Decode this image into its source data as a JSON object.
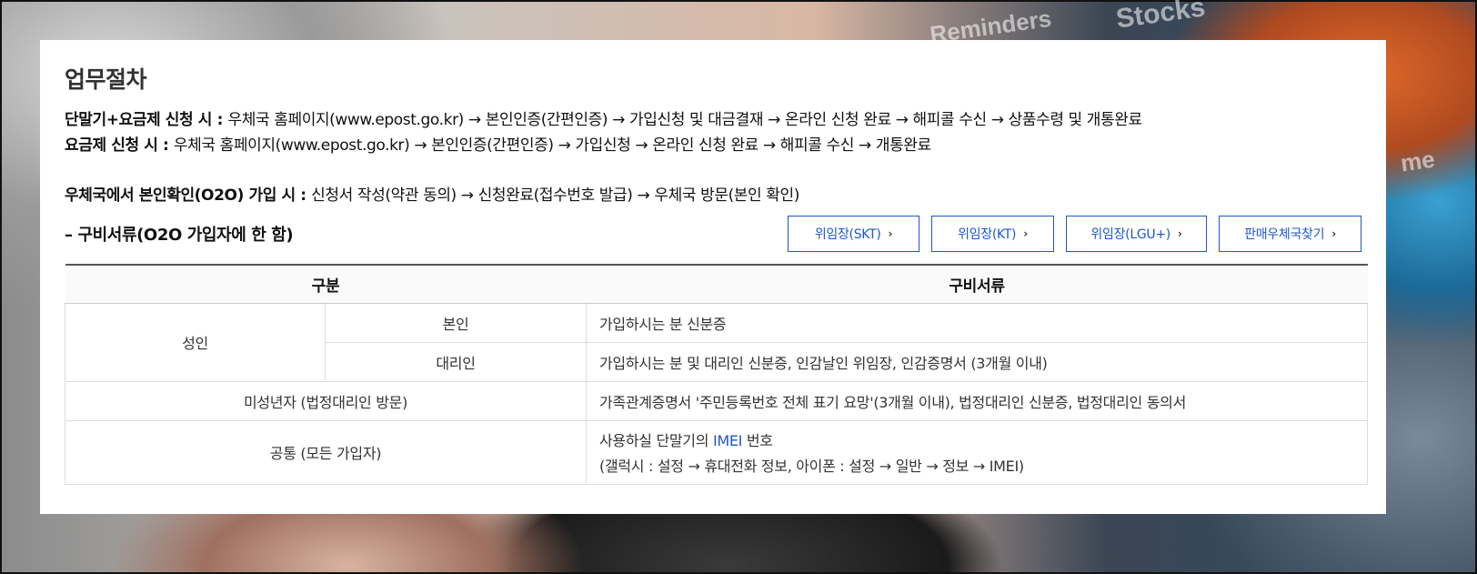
{
  "background": {
    "texts": [
      "Stocks",
      "Reminders",
      "me"
    ]
  },
  "panel": {
    "title": "업무절차",
    "lines": [
      {
        "label": "단말기+요금제 신청 시",
        "sep": " : ",
        "text": "우체국 홈페이지(www.epost.go.kr) → 본인인증(간편인증) → 가입신청 및 대금결재 → 온라인 신청 완료 → 해피콜 수신 → 상품수령 및 개통완료"
      },
      {
        "label": "요금제 신청 시",
        "sep": " : ",
        "text": "우체국 홈페이지(www.epost.go.kr) → 본인인증(간편인증) → 가입신청 → 온라인 신청 완료 → 해피콜 수신 → 개통완료"
      },
      {
        "label": "우체국에서 본인확인(O2O) 가입 시",
        "sep": " : ",
        "text": "신청서 작성(약관 동의) → 신청완료(접수번호 발급) → 우체국 방문(본인 확인)"
      }
    ],
    "docs_title": "– 구비서류(O2O 가입자에 한 함)",
    "buttons": [
      "위임장(SKT)",
      "위임장(KT)",
      "위임장(LGU+)",
      "판매우체국찾기"
    ],
    "chevron": "›",
    "table": {
      "headers": [
        "구분",
        "구비서류"
      ],
      "rows": {
        "adult": "성인",
        "self": "본인",
        "self_doc": "가입하시는 분 신분증",
        "proxy": "대리인",
        "proxy_doc": "가입하시는 분 및 대리인 신분증, 인감날인 위임장, 인감증명서 (3개월 이내)",
        "minor": "미성년자 (법정대리인 방문)",
        "minor_doc": "가족관계증명서 '주민등록번호 전체 표기 요망'(3개월 이내), 법정대리인 신분증, 법정대리인 동의서",
        "common": "공통 (모든 가입자)",
        "common_doc_pre": "사용하실 단말기의 ",
        "common_doc_link": "IMEI",
        "common_doc_post": " 번호",
        "common_doc_sub": "(갤럭시 : 설정 → 휴대전화 정보,  아이폰 : 설정 → 일반 → 정보 → IMEI)"
      }
    }
  }
}
